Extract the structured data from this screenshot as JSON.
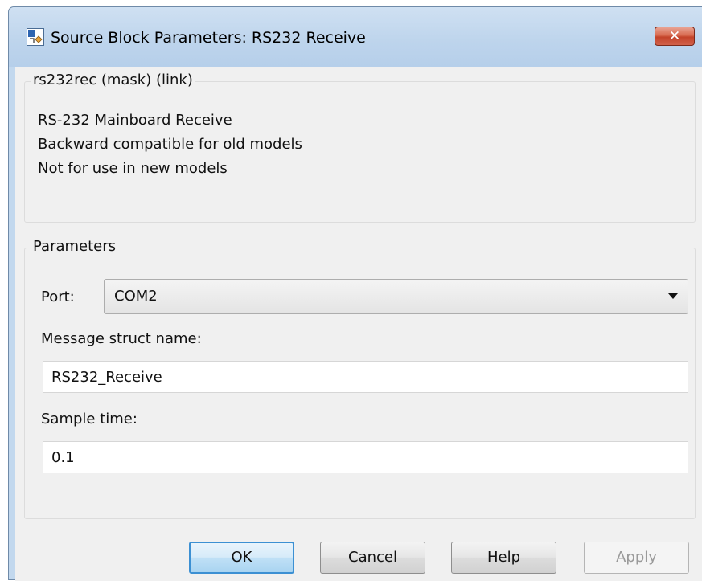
{
  "window": {
    "title": "Source Block Parameters: RS232 Receive",
    "close_glyph": "✕",
    "icon": "simulink-block-icon"
  },
  "description_group": {
    "legend": "rs232rec (mask) (link)",
    "lines": [
      "RS-232 Mainboard Receive",
      "Backward compatible for old models",
      "Not for use in new models"
    ]
  },
  "parameters_group": {
    "legend": "Parameters",
    "port": {
      "label": "Port:",
      "value": "COM2"
    },
    "message_struct": {
      "label": "Message struct name:",
      "value": "RS232_Receive"
    },
    "sample_time": {
      "label": "Sample time:",
      "value": "0.1"
    }
  },
  "buttons": {
    "ok": "OK",
    "cancel": "Cancel",
    "help": "Help",
    "apply": "Apply"
  },
  "colors": {
    "default_button_border": "#3c90d3",
    "close_button": "#c3432a",
    "title_bar": "#bdd4ec"
  }
}
